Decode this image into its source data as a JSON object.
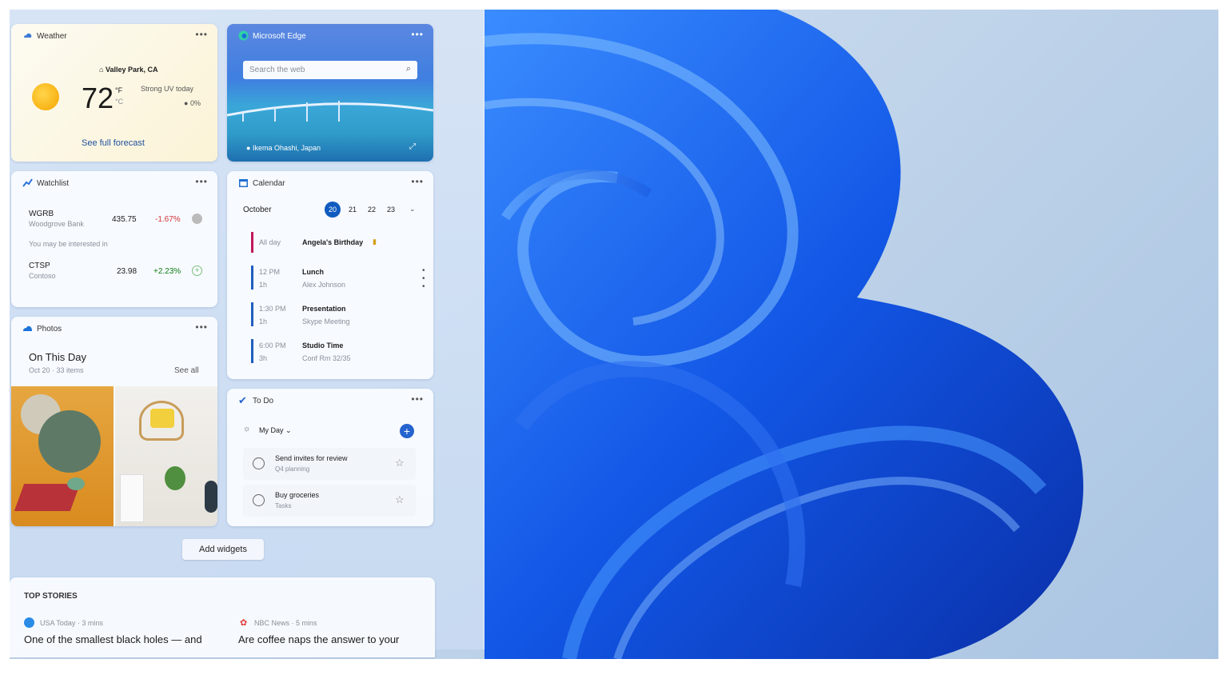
{
  "weather": {
    "title": "Weather",
    "location": "Valley Park, CA",
    "temperature": "72",
    "unit_f": "°F",
    "unit_c": "°C",
    "condition": "Strong UV today",
    "precip": "0%",
    "forecast_link": "See full forecast"
  },
  "edge": {
    "title": "Microsoft Edge",
    "search_placeholder": "Search the web",
    "photo_location": "Ikema Ohashi, Japan"
  },
  "watchlist": {
    "title": "Watchlist",
    "stocks": [
      {
        "symbol": "WGRB",
        "name": "Woodgrove Bank",
        "price": "435.75",
        "change": "-1.67%"
      },
      {
        "symbol": "CTSP",
        "name": "Contoso",
        "price": "23.98",
        "change": "+2.23%"
      }
    ],
    "interest_label": "You may be interested in"
  },
  "photos": {
    "title": "Photos",
    "heading": "On This Day",
    "subtitle": "Oct 20 · 33 items",
    "see_all": "See all"
  },
  "calendar": {
    "title": "Calendar",
    "month": "October",
    "days": [
      "20",
      "21",
      "22",
      "23"
    ],
    "events": [
      {
        "time": "All day",
        "duration": "",
        "title": "Angela's Birthday",
        "detail": "",
        "color": "#c2185b"
      },
      {
        "time": "12 PM",
        "duration": "1h",
        "title": "Lunch",
        "detail": "Alex Johnson",
        "color": "#1f5fbf"
      },
      {
        "time": "1:30 PM",
        "duration": "1h",
        "title": "Presentation",
        "detail": "Skype Meeting",
        "color": "#1f5fbf"
      },
      {
        "time": "6:00 PM",
        "duration": "3h",
        "title": "Studio Time",
        "detail": "Conf Rm 32/35",
        "color": "#1f5fbf"
      }
    ]
  },
  "todo": {
    "title": "To Do",
    "list_name": "My Day",
    "tasks": [
      {
        "title": "Send invites for review",
        "subtitle": "Q4 planning"
      },
      {
        "title": "Buy groceries",
        "subtitle": "Tasks"
      }
    ]
  },
  "add_widgets": "Add widgets",
  "top_stories": {
    "heading": "TOP STORIES",
    "stories": [
      {
        "source": "USA Today · 3 mins",
        "headline": "One of the smallest black holes — and"
      },
      {
        "source": "NBC News · 5 mins",
        "headline": "Are coffee naps the answer to your"
      }
    ]
  },
  "colors": {
    "accent": "#0067c0",
    "negative": "#d13438",
    "positive": "#107c10"
  },
  "taskbar": {
    "icons": [
      "windows-start-icon",
      "search-icon",
      "task-view-icon",
      "widgets-icon",
      "chat-icon",
      "file-explorer-icon",
      "edge-icon",
      "store-icon"
    ],
    "tray": [
      "chevron-up-icon",
      "wifi-icon",
      "volume-icon",
      "battery-icon"
    ]
  }
}
